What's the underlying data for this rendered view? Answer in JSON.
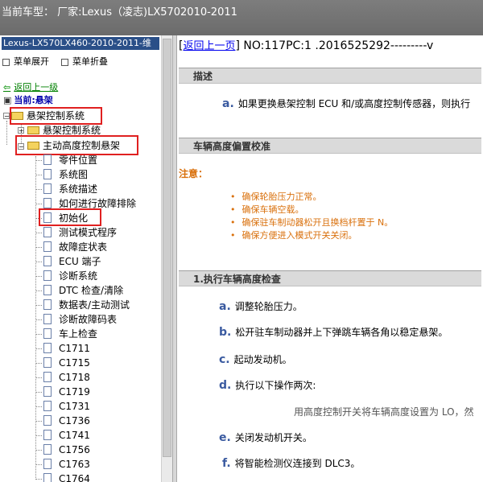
{
  "window_title": "当前车型： 厂家:Lexus（凌志)LX5702010-2011",
  "sidebar": {
    "doc_title": "Lexus-LX570LX460-2010-2011-维",
    "expand_all": "菜单展开",
    "collapse_all": "菜单折叠",
    "back": "返回上一级",
    "current": "当前:悬架",
    "root": "悬架控制系统",
    "child_collapsed": "悬架控制系统",
    "child_expanded": "主动高度控制悬架",
    "items": [
      "零件位置",
      "系统图",
      "系统描述",
      "如何进行故障排除",
      "初始化",
      "测试模式程序",
      "故障症状表",
      "ECU 端子",
      "诊断系统",
      "DTC 检查/清除",
      "数据表/主动测试",
      "诊断故障码表",
      "车上检查",
      "C1711",
      "C1715",
      "C1718",
      "C1719",
      "C1731",
      "C1736",
      "C1741",
      "C1756",
      "C1763",
      "C1764"
    ]
  },
  "content": {
    "back_link": "返回上一页",
    "header_text": "NO:117PC:1 .2016525292---------v",
    "sections": {
      "desc": "描述",
      "offset": "车辆高度偏置校准",
      "check": "1.执行车辆高度检查"
    },
    "desc_step": {
      "letter": "a.",
      "text": "如果更换悬架控制 ECU 和/或高度控制传感器，则执行"
    },
    "note_label": "注意：",
    "notes": [
      "确保轮胎压力正常。",
      "确保车辆空载。",
      "确保驻车制动器松开且换档杆置于 N。",
      "确保方便进入模式开关关闭。"
    ],
    "steps": [
      {
        "letter": "a.",
        "text": "调整轮胎压力。"
      },
      {
        "letter": "b.",
        "text": "松开驻车制动器并上下弹跳车辆各角以稳定悬架。"
      },
      {
        "letter": "c.",
        "text": "起动发动机。"
      },
      {
        "letter": "d.",
        "text": "执行以下操作两次:"
      },
      {
        "letter": "e.",
        "text": "关闭发动机开关。"
      },
      {
        "letter": "f.",
        "text": "将智能检测仪连接到 DLC3。"
      }
    ],
    "sub_step": "用高度控制开关将车辆高度设置为 LO，然"
  }
}
